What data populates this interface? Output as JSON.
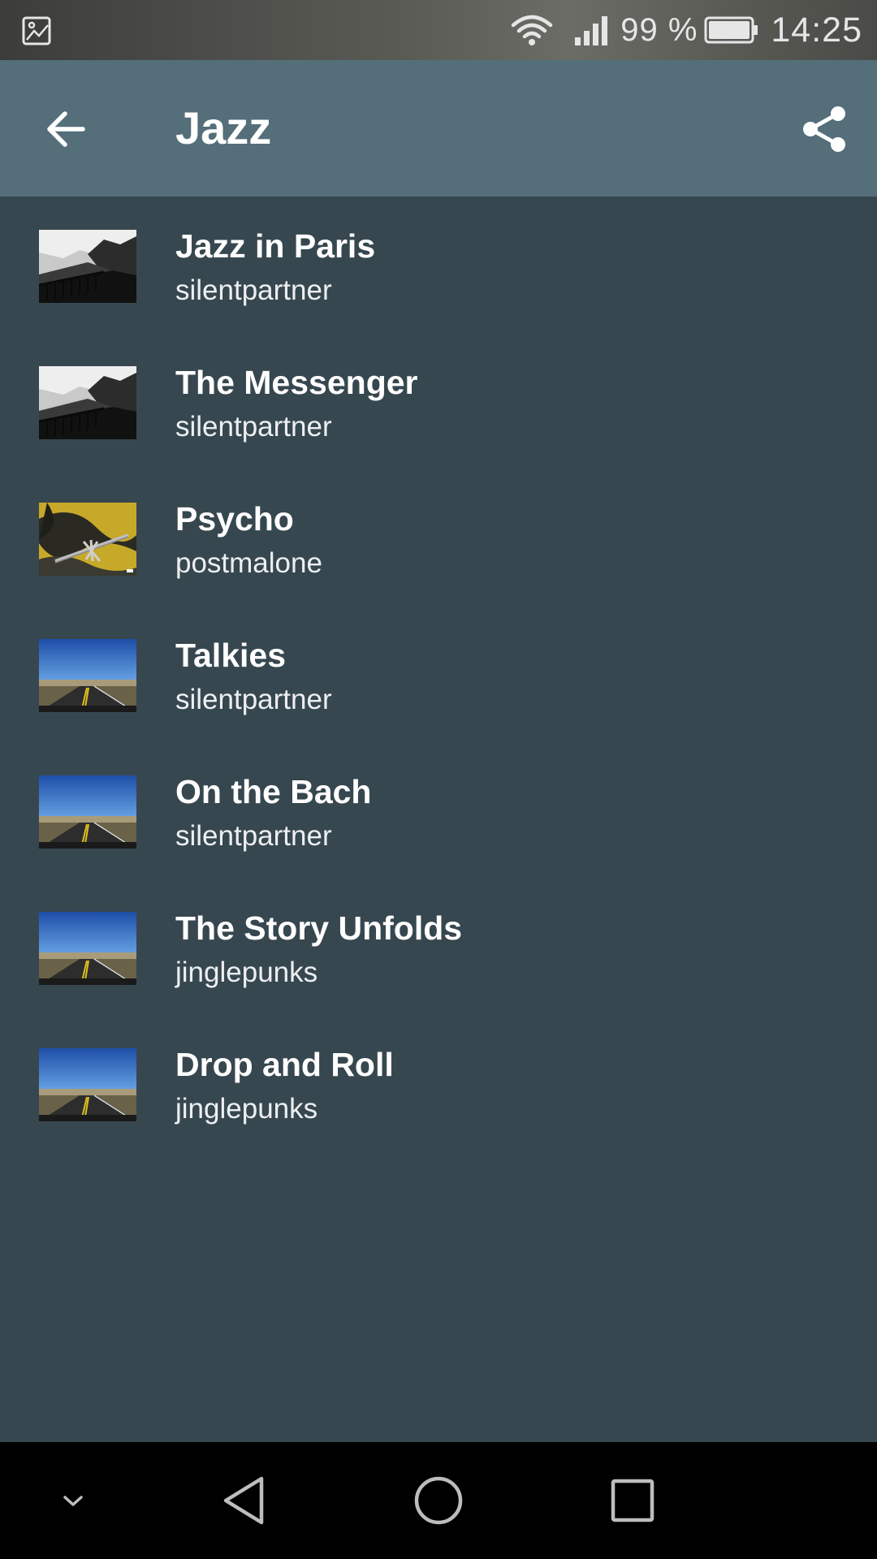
{
  "status_bar": {
    "battery_percent": "99 %",
    "time": "14:25",
    "left_icon": "image-icon",
    "icons": [
      "wifi-icon",
      "signal-icon",
      "battery-icon"
    ]
  },
  "app_bar": {
    "title": "Jazz",
    "back_icon": "arrow-back-icon",
    "share_icon": "share-icon",
    "background": "#546e7a"
  },
  "tracks": [
    {
      "title": "Jazz in Paris",
      "artist": "silentpartner",
      "artwork": "coast-bw"
    },
    {
      "title": "The Messenger",
      "artist": "silentpartner",
      "artwork": "coast-bw"
    },
    {
      "title": "Psycho",
      "artist": "postmalone",
      "artwork": "barbed-wire-yellow"
    },
    {
      "title": "Talkies",
      "artist": "silentpartner",
      "artwork": "desert-road"
    },
    {
      "title": "On the Bach",
      "artist": "silentpartner",
      "artwork": "desert-road"
    },
    {
      "title": "The Story Unfolds",
      "artist": "jinglepunks",
      "artwork": "desert-road"
    },
    {
      "title": "Drop and Roll",
      "artist": "jinglepunks",
      "artwork": "desert-road"
    }
  ],
  "nav_bar": {
    "buttons": [
      "collapse-icon",
      "back-triangle-icon",
      "home-circle-icon",
      "recents-square-icon"
    ]
  },
  "colors": {
    "list_background": "#37474f",
    "app_bar": "#546e7a",
    "nav_bar": "#000000"
  }
}
